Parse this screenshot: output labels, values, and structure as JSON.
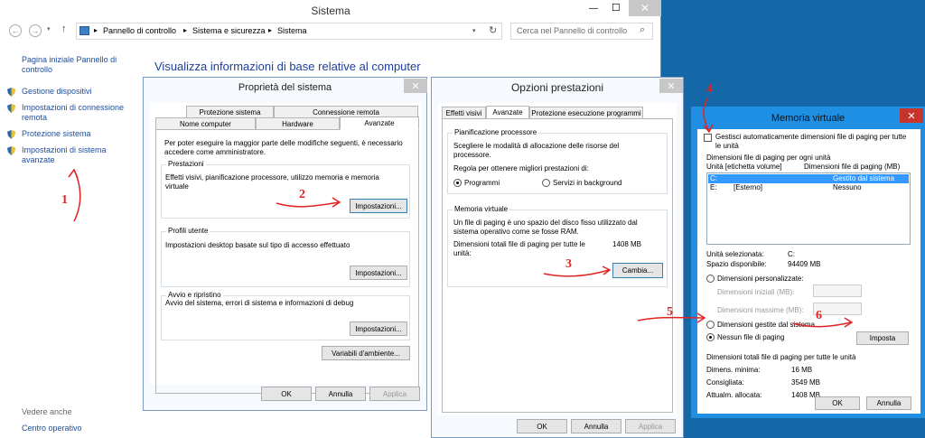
{
  "main_window": {
    "title": "Sistema",
    "breadcrumb": [
      "Pannello di controllo",
      "Sistema e sicurezza",
      "Sistema"
    ],
    "search_placeholder": "Cerca nel Pannello di controllo",
    "heading": "Visualizza informazioni di base relative al computer",
    "sidebar_home": "Pagina iniziale Pannello di controllo",
    "sidebar_items": [
      "Gestione dispositivi",
      "Impostazioni di connessione remota",
      "Protezione sistema",
      "Impostazioni di sistema avanzate"
    ],
    "see_also": "Vedere anche",
    "see_also_item": "Centro operativo"
  },
  "sysprops": {
    "title": "Proprietà del sistema",
    "tabs_row1": [
      "Protezione sistema",
      "Connessione remota"
    ],
    "tabs_row2": [
      "Nome computer",
      "Hardware",
      "Avanzate"
    ],
    "intro": "Per poter eseguire la maggior parte delle modifiche seguenti, è necessario accedere come amministratore.",
    "perf_title": "Prestazioni",
    "perf_desc": "Effetti visivi, pianificazione processore, utilizzo memoria e memoria virtuale",
    "settings_btn": "Impostazioni...",
    "profiles_title": "Profili utente",
    "profiles_desc": "Impostazioni desktop basate sul tipo di accesso effettuato",
    "startup_title": "Avvio e ripristino",
    "startup_desc": "Avvio del sistema, errori di sistema e informazioni di debug",
    "env_btn": "Variabili d'ambiente...",
    "ok": "OK",
    "cancel": "Annulla",
    "apply": "Applica"
  },
  "perfopts": {
    "title": "Opzioni prestazioni",
    "tabs": [
      "Effetti visivi",
      "Avanzate",
      "Protezione esecuzione programmi"
    ],
    "sched_title": "Pianificazione processore",
    "sched_desc": "Scegliere le modalità di allocazione delle risorse del processore.",
    "sched_prompt": "Regola per ottenere migliori prestazioni di:",
    "opt_programs": "Programmi",
    "opt_services": "Servizi in background",
    "vm_title": "Memoria virtuale",
    "vm_desc": "Un file di paging è uno spazio del disco fisso utilizzato dal sistema operativo come se fosse RAM.",
    "vm_total_label": "Dimensioni totali file di paging per tutte le unità:",
    "vm_total_value": "1408 MB",
    "change_btn": "Cambia...",
    "ok": "OK",
    "cancel": "Annulla",
    "apply": "Applica"
  },
  "virtmem": {
    "title": "Memoria virtuale",
    "auto_label": "Gestisci automaticamente dimensioni file di paging per tutte le unità",
    "list_caption": "Dimensioni file di paging per ogni unità",
    "col_drive": "Unità [etichetta volume]",
    "col_size": "Dimensioni file di paging (MB)",
    "rows": [
      {
        "drive": "C:",
        "label": "",
        "size": "Gestito dal sistema"
      },
      {
        "drive": "E:",
        "label": "[Esterno]",
        "size": "Nessuno"
      }
    ],
    "selected_label": "Unità selezionata:",
    "selected_value": "C:",
    "space_label": "Spazio disponibile:",
    "space_value": "94409 MB",
    "opt_custom": "Dimensioni personalizzate:",
    "initial_label": "Dimensioni iniziali (MB):",
    "max_label": "Dimensioni massime (MB):",
    "opt_system": "Dimensioni gestite dal sistema",
    "opt_none": "Nessun file di paging",
    "set_btn": "Imposta",
    "totals_title": "Dimensioni totali file di paging per tutte le unità",
    "min_label": "Dimens. minima:",
    "min_value": "16 MB",
    "rec_label": "Consigliata:",
    "rec_value": "3549 MB",
    "alloc_label": "Attualm. allocata:",
    "alloc_value": "1408 MB",
    "ok": "OK",
    "cancel": "Annulla"
  },
  "annotations": [
    "1",
    "2",
    "3",
    "4",
    "5",
    "6"
  ],
  "colors": {
    "annotation": "#e02424",
    "desktop": "#1568a8",
    "link": "#1e4fa0",
    "selection": "#3399ff"
  },
  "icons": [
    "back-arrow-icon",
    "forward-arrow-icon",
    "up-arrow-icon",
    "computer-icon",
    "search-icon",
    "refresh-icon",
    "shield-icon",
    "close-icon",
    "minimize-icon",
    "maximize-icon"
  ]
}
